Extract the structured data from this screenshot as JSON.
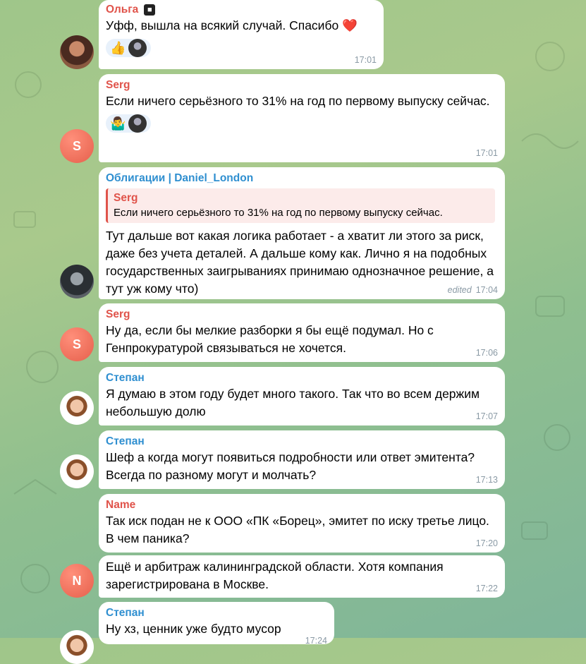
{
  "messages": [
    {
      "author": "Ольга",
      "text": "Уфф, вышла на всякий случай. Спасибо ❤️",
      "time": "17:01",
      "reactions": [
        "👍"
      ]
    },
    {
      "author": "Serg",
      "text": "Если ничего серьёзного то 31% на год по первому выпуску сейчас.",
      "time": "17:01",
      "avatar_letter": "S",
      "reactions": [
        "🤷‍♂️"
      ]
    },
    {
      "author": "Облигации | Daniel_London",
      "quote_author": "Serg",
      "quote_text": "Если ничего серьёзного то 31% на год по первому выпуску сейчас.",
      "text": "Тут дальше вот какая логика работает - а хватит ли этого за риск, даже без учета деталей. А дальше кому как. Лично я на подобных государственных заигрываниях принимаю однозначное решение, а тут уж кому что)",
      "edited": "edited",
      "time": "17:04"
    },
    {
      "author": "Serg",
      "text": "Ну да, если бы мелкие разборки я бы ещё подумал. Но с Генпрокуратурой связываться не хочется.",
      "time": "17:06",
      "avatar_letter": "S"
    },
    {
      "author": "Степан",
      "text": "Я думаю в этом году будет много такого. Так что во всем держим небольшую долю",
      "time": "17:07"
    },
    {
      "author": "Степан",
      "text": "Шеф а когда могут появиться подробности или ответ эмитента? Всегда по разному могут и молчать?",
      "time": "17:13"
    },
    {
      "author": "Name",
      "text": "Так иск подан не к ООО «ПК «Борец», эмитет по иску третье лицо. В чем паника?",
      "time": "17:20"
    },
    {
      "text": "Ещё и арбитраж калининградской области. Хотя компания зарегистрирована в Москве.",
      "time": "17:22",
      "avatar_letter": "N"
    },
    {
      "author": "Степан",
      "text": "Ну хз, ценник уже будто мусор",
      "time": "17:24"
    }
  ],
  "colors": {
    "author_red": "#e0534a",
    "author_blue": "#2f8fd0",
    "time": "#8a9aa5"
  }
}
